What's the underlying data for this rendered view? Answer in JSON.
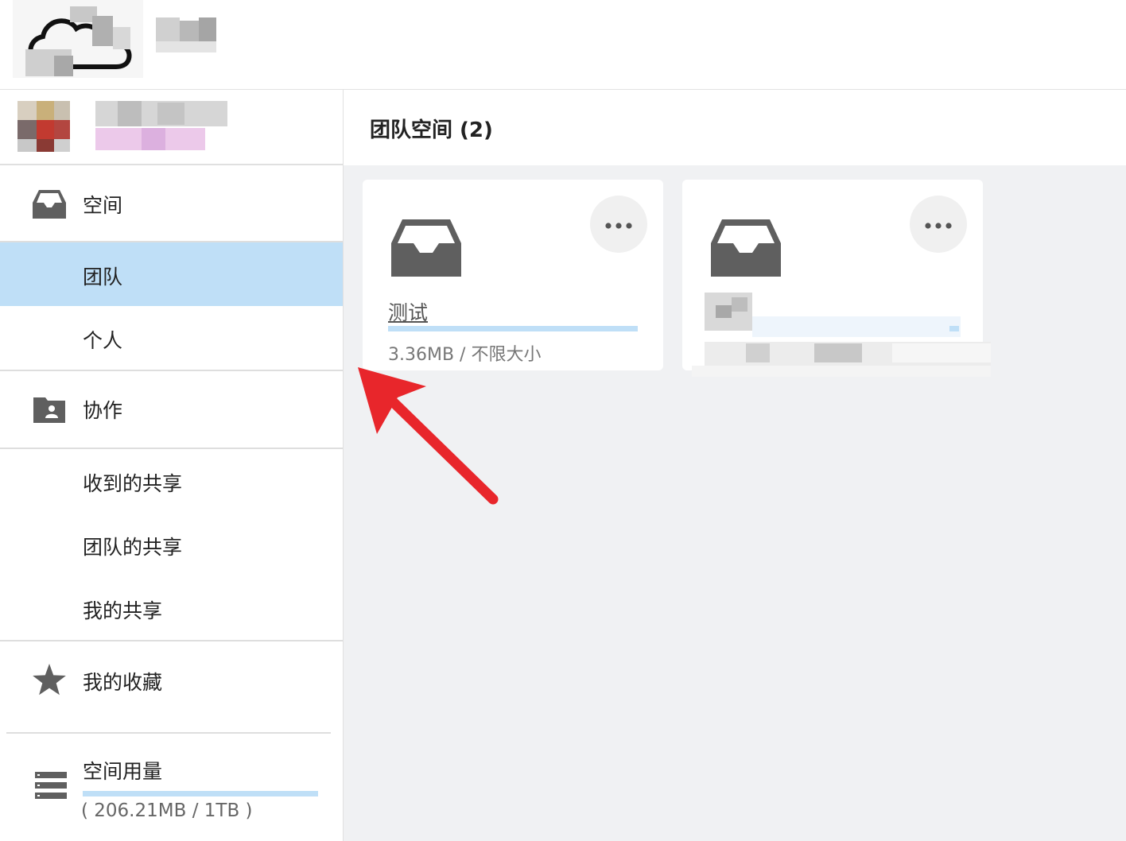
{
  "sidebar": {
    "spaces": {
      "label": "空间",
      "icon": "inbox-tray-icon"
    },
    "team": {
      "label": "团队"
    },
    "personal": {
      "label": "个人"
    },
    "collab": {
      "label": "协作",
      "icon": "shared-folder-icon"
    },
    "received_shares": {
      "label": "收到的共享"
    },
    "team_shares": {
      "label": "团队的共享"
    },
    "my_shares": {
      "label": "我的共享"
    },
    "favorites": {
      "label": "我的收藏",
      "icon": "star-icon"
    },
    "usage": {
      "label": "空间用量",
      "value": "( 206.21MB / 1TB )",
      "icon": "storage-icon"
    }
  },
  "main": {
    "title": "团队空间 (2)",
    "cards": [
      {
        "name": "测试",
        "size": "3.36MB / 不限大小"
      }
    ]
  },
  "colors": {
    "accent": "#bfdff7",
    "annotation": "#e8262b",
    "icon": "#5f5f5f"
  }
}
